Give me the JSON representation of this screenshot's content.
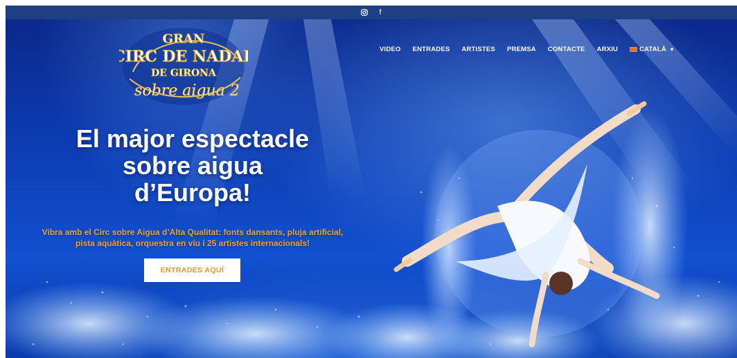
{
  "social": {
    "instagram_icon": "instagram-icon",
    "facebook_icon": "facebook-icon",
    "facebook_glyph": "f"
  },
  "logo": {
    "line1": "GRAN",
    "line2": "CIRC DE NADAL",
    "line3": "DE GIRONA",
    "line4": "sobre aigua 2"
  },
  "nav": {
    "items": [
      "VIDEO",
      "ENTRADES",
      "ARTISTES",
      "PREMSA",
      "CONTACTE",
      "ARXIU"
    ],
    "language": "CATALÀ",
    "language_flag_icon": "catalan-flag-icon",
    "dropdown_icon": "chevron-down-icon"
  },
  "hero": {
    "headline": [
      "El major espectacle",
      "sobre aigua",
      "d’Europa!"
    ],
    "subtitle": [
      "Vibra amb el Circ sobre Aigua d’Alta Qualitat: fonts dansants, pluja artificial,",
      "pista aquàtica, orquestra en viu i 25 artistes internacionals!"
    ],
    "cta_label": "ENTRADES AQUÍ"
  },
  "colors": {
    "topbar": "#1d3f83",
    "hero_blue": "#0d3bb0",
    "accent_orange": "#f0a12a",
    "cta_text": "#e8952a",
    "logo_gold": "#e9c15a"
  }
}
